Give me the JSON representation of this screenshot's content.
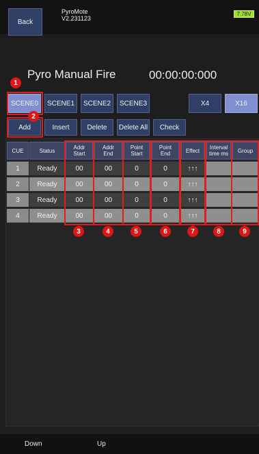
{
  "header": {
    "back_label": "Back",
    "app_name": "PyroMote",
    "version": "V2.231123",
    "battery": "7.78V"
  },
  "title": "Pyro Manual Fire",
  "timer": "00:00:00:000",
  "scenes": [
    "SCENE0",
    "SCENE1",
    "SCENE2",
    "SCENE3"
  ],
  "multipliers": [
    "X4",
    "X16"
  ],
  "actions": [
    "Add",
    "Insert",
    "Delete",
    "Delete All",
    "Check"
  ],
  "columns": [
    "CUE",
    "Status",
    "Addr\nStart",
    "Addr\nEnd",
    "Point\nStart",
    "Point\nEnd",
    "Effect",
    "Interval\ntime ms",
    "Group"
  ],
  "rows": [
    {
      "cue": "1",
      "status": "Ready",
      "addr_start": "00",
      "addr_end": "00",
      "point_start": "0",
      "point_end": "0",
      "effect": "↑↑↑",
      "interval": "",
      "group": ""
    },
    {
      "cue": "2",
      "status": "Ready",
      "addr_start": "00",
      "addr_end": "00",
      "point_start": "0",
      "point_end": "0",
      "effect": "↑↑↑",
      "interval": "",
      "group": ""
    },
    {
      "cue": "3",
      "status": "Ready",
      "addr_start": "00",
      "addr_end": "00",
      "point_start": "0",
      "point_end": "0",
      "effect": "↑↑↑",
      "interval": "",
      "group": ""
    },
    {
      "cue": "4",
      "status": "Ready",
      "addr_start": "00",
      "addr_end": "00",
      "point_start": "0",
      "point_end": "0",
      "effect": "↑↑↑",
      "interval": "",
      "group": ""
    }
  ],
  "markers": [
    "1",
    "2",
    "3",
    "4",
    "5",
    "6",
    "7",
    "8",
    "9"
  ],
  "footer": {
    "down": "Down",
    "up": "Up"
  },
  "colors": {
    "button": "#2f3f66",
    "selected": "#7f8fd0",
    "annotation": "#e01e1e",
    "battery": "#9fe02a"
  }
}
